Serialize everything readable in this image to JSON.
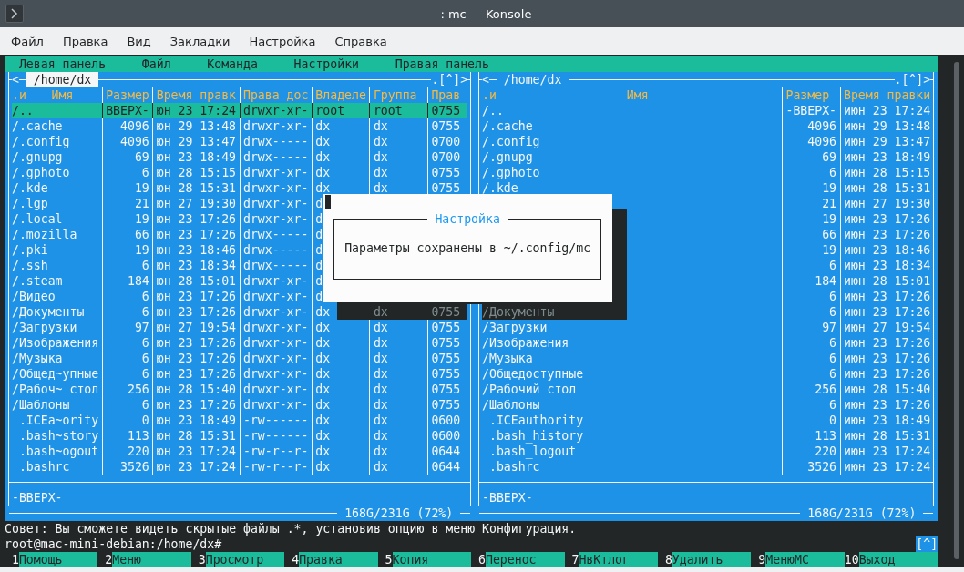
{
  "window": {
    "title": "- : mc — Konsole"
  },
  "menu": [
    "Файл",
    "Правка",
    "Вид",
    "Закладки",
    "Настройка",
    "Справка"
  ],
  "mc_menu": [
    "Левая панель",
    "Файл",
    "Команда",
    "Настройки",
    "Правая панель"
  ],
  "panels": [
    {
      "kind": "full",
      "active": true,
      "left_marker": "<",
      "path": "/home/dx",
      "right_marker": ".[^]>",
      "sort_indicator": ".и",
      "columns": [
        "Имя",
        "Размер",
        "Время правк",
        "Права дос",
        "Владеле",
        "Группа",
        "Прав"
      ],
      "rows": [
        {
          "kind": "dir",
          "name": "/..",
          "size": "ВВЕРХ-",
          "time": "юн 23 17:24",
          "perms": "drwxr-xr-",
          "owner": "root",
          "group": "root",
          "mode": "0755",
          "selected": true
        },
        {
          "kind": "dir",
          "name": "/.cache",
          "size": "4096",
          "time": "юн 29 13:48",
          "perms": "drwxr-xr-",
          "owner": "dx",
          "group": "dx",
          "mode": "0755",
          "selected": false
        },
        {
          "kind": "dir",
          "name": "/.config",
          "size": "4096",
          "time": "юн 29 13:47",
          "perms": "drwx-----",
          "owner": "dx",
          "group": "dx",
          "mode": "0700",
          "selected": false
        },
        {
          "kind": "dir",
          "name": "/.gnupg",
          "size": "69",
          "time": "юн 23 18:49",
          "perms": "drwx-----",
          "owner": "dx",
          "group": "dx",
          "mode": "0700",
          "selected": false
        },
        {
          "kind": "dir",
          "name": "/.gphoto",
          "size": "6",
          "time": "юн 28 15:15",
          "perms": "drwxr-xr-",
          "owner": "dx",
          "group": "dx",
          "mode": "0755",
          "selected": false
        },
        {
          "kind": "dir",
          "name": "/.kde",
          "size": "19",
          "time": "юн 28 15:31",
          "perms": "drwxr-xr-",
          "owner": "dx",
          "group": "dx",
          "mode": "0755",
          "selected": false
        },
        {
          "kind": "dir",
          "name": "/.lgp",
          "size": "21",
          "time": "юн 27 19:30",
          "perms": "drwxr-xr-",
          "owner": "d",
          "selected": false
        },
        {
          "kind": "dir",
          "name": "/.local",
          "size": "19",
          "time": "юн 23 17:26",
          "perms": "drwxr-xr-",
          "owner": "d",
          "selected": false
        },
        {
          "kind": "dir",
          "name": "/.mozilla",
          "size": "66",
          "time": "юн 23 17:26",
          "perms": "drwx-----",
          "owner": "d",
          "selected": false
        },
        {
          "kind": "dir",
          "name": "/.pki",
          "size": "19",
          "time": "юн 23 18:46",
          "perms": "drwx-----",
          "owner": "d",
          "selected": false
        },
        {
          "kind": "dir",
          "name": "/.ssh",
          "size": "6",
          "time": "юн 23 18:34",
          "perms": "drwx-----",
          "owner": "d",
          "selected": false
        },
        {
          "kind": "dir",
          "name": "/.steam",
          "size": "184",
          "time": "юн 28 15:01",
          "perms": "drwxr-xr-",
          "owner": "d",
          "selected": false
        },
        {
          "kind": "dir",
          "name": "/Видео",
          "size": "6",
          "time": "юн 23 17:26",
          "perms": "drwxr-xr-",
          "owner": "d",
          "selected": false
        },
        {
          "kind": "dir",
          "name": "/Документы",
          "size": "6",
          "time": "юн 23 17:26",
          "perms": "drwxr-xr-",
          "owner": "dx",
          "group": "dx",
          "mode": "0755",
          "selected": false,
          "shaded": true
        },
        {
          "kind": "dir",
          "name": "/Загрузки",
          "size": "97",
          "time": "юн 27 19:54",
          "perms": "drwxr-xr-",
          "owner": "dx",
          "group": "dx",
          "mode": "0755",
          "selected": false
        },
        {
          "kind": "dir",
          "name": "/Изображения",
          "size": "6",
          "time": "юн 23 17:26",
          "perms": "drwxr-xr-",
          "owner": "dx",
          "group": "dx",
          "mode": "0755",
          "selected": false
        },
        {
          "kind": "dir",
          "name": "/Музыка",
          "size": "6",
          "time": "юн 23 17:26",
          "perms": "drwxr-xr-",
          "owner": "dx",
          "group": "dx",
          "mode": "0755",
          "selected": false
        },
        {
          "kind": "dir",
          "name": "/Общед~упные",
          "size": "6",
          "time": "юн 23 17:26",
          "perms": "drwxr-xr-",
          "owner": "dx",
          "group": "dx",
          "mode": "0755",
          "selected": false
        },
        {
          "kind": "dir",
          "name": "/Рабоч~ стол",
          "size": "256",
          "time": "юн 28 15:40",
          "perms": "drwxr-xr-",
          "owner": "dx",
          "group": "dx",
          "mode": "0755",
          "selected": false
        },
        {
          "kind": "dir",
          "name": "/Шаблоны",
          "size": "6",
          "time": "юн 23 17:26",
          "perms": "drwxr-xr-",
          "owner": "dx",
          "group": "dx",
          "mode": "0755",
          "selected": false
        },
        {
          "kind": "file",
          "name": ".ICEa~ority",
          "size": "0",
          "time": "юн 23 18:49",
          "perms": "-rw------",
          "owner": "dx",
          "group": "dx",
          "mode": "0600",
          "selected": false
        },
        {
          "kind": "file",
          "name": ".bash~story",
          "size": "113",
          "time": "юн 28 15:31",
          "perms": "-rw------",
          "owner": "dx",
          "group": "dx",
          "mode": "0600",
          "selected": false
        },
        {
          "kind": "file",
          "name": ".bash~ogout",
          "size": "220",
          "time": "юн 23 17:24",
          "perms": "-rw-r--r-",
          "owner": "dx",
          "group": "dx",
          "mode": "0644",
          "selected": false
        },
        {
          "kind": "file",
          "name": ".bashrc",
          "size": "3526",
          "time": "юн 23 17:24",
          "perms": "-rw-r--r-",
          "owner": "dx",
          "group": "dx",
          "mode": "0644",
          "selected": false
        }
      ],
      "mini_status": "-ВВЕРХ-",
      "disk_usage": "168G/231G (72%)"
    },
    {
      "kind": "wide",
      "active": false,
      "left_marker": "<",
      "path": "/home/dx",
      "right_marker": ".[^]>",
      "sort_indicator": ".и",
      "columns": [
        "Имя",
        "Размер",
        "Время правки"
      ],
      "rows": [
        {
          "kind": "dir",
          "name": "/..",
          "size": "-ВВЕРХ-",
          "time": "июн 23 17:24",
          "selected": false
        },
        {
          "kind": "dir",
          "name": "/.cache",
          "size": "4096",
          "time": "июн 29 13:48",
          "selected": false
        },
        {
          "kind": "dir",
          "name": "/.config",
          "size": "4096",
          "time": "июн 29 13:47",
          "selected": false
        },
        {
          "kind": "dir",
          "name": "/.gnupg",
          "size": "69",
          "time": "июн 23 18:49",
          "selected": false
        },
        {
          "kind": "dir",
          "name": "/.gphoto",
          "size": "6",
          "time": "июн 28 15:15",
          "selected": false
        },
        {
          "kind": "dir",
          "name": "/.kde",
          "size": "19",
          "time": "июн 28 15:31",
          "selected": false
        },
        {
          "kind": "dir",
          "size": "21",
          "time": "июн 27 19:30",
          "selected": false
        },
        {
          "kind": "dir",
          "size": "19",
          "time": "июн 23 17:26",
          "selected": false
        },
        {
          "kind": "dir",
          "size": "66",
          "time": "июн 23 17:26",
          "selected": false
        },
        {
          "kind": "dir",
          "size": "19",
          "time": "июн 23 18:46",
          "selected": false
        },
        {
          "kind": "dir",
          "size": "6",
          "time": "июн 23 18:34",
          "selected": false
        },
        {
          "kind": "dir",
          "size": "184",
          "time": "июн 28 15:01",
          "selected": false
        },
        {
          "kind": "dir",
          "size": "6",
          "time": "июн 23 17:26",
          "selected": false
        },
        {
          "kind": "dir",
          "name": "/Документы",
          "size": "6",
          "time": "июн 23 17:26",
          "selected": false,
          "shaded": true
        },
        {
          "kind": "dir",
          "name": "/Загрузки",
          "size": "97",
          "time": "июн 27 19:54",
          "selected": false
        },
        {
          "kind": "dir",
          "name": "/Изображения",
          "size": "6",
          "time": "июн 23 17:26",
          "selected": false
        },
        {
          "kind": "dir",
          "name": "/Музыка",
          "size": "6",
          "time": "июн 23 17:26",
          "selected": false
        },
        {
          "kind": "dir",
          "name": "/Общедоступные",
          "size": "6",
          "time": "июн 23 17:26",
          "selected": false
        },
        {
          "kind": "dir",
          "name": "/Рабочий стол",
          "size": "256",
          "time": "июн 28 15:40",
          "selected": false
        },
        {
          "kind": "dir",
          "name": "/Шаблоны",
          "size": "6",
          "time": "июн 23 17:26",
          "selected": false
        },
        {
          "kind": "file",
          "name": ".ICEauthority",
          "size": "0",
          "time": "июн 23 18:49",
          "selected": false
        },
        {
          "kind": "file",
          "name": ".bash_history",
          "size": "113",
          "time": "июн 28 15:31",
          "selected": false
        },
        {
          "kind": "file",
          "name": ".bash_logout",
          "size": "220",
          "time": "июн 23 17:24",
          "selected": false
        },
        {
          "kind": "file",
          "name": ".bashrc",
          "size": "3526",
          "time": "июн 23 17:24",
          "selected": false
        }
      ],
      "mini_status": "-ВВЕРХ-",
      "disk_usage": "168G/231G (72%)"
    }
  ],
  "dialog": {
    "title": "Настройка",
    "message": "Параметры сохранены в ~/.config/mc"
  },
  "hint": "Совет: Вы сможете видеть скрытые файлы .*, установив опцию в меню Конфигурация.",
  "prompt": "root@mac-mini-debian:/home/dx#",
  "prompt_badge": "[^]",
  "function_keys": [
    {
      "key": "1",
      "label": "Помощь"
    },
    {
      "key": "2",
      "label": "Меню"
    },
    {
      "key": "3",
      "label": "Просмотр"
    },
    {
      "key": "4",
      "label": "Правка"
    },
    {
      "key": "5",
      "label": "Копия"
    },
    {
      "key": "6",
      "label": "Перенос"
    },
    {
      "key": "7",
      "label": "НвКтлог"
    },
    {
      "key": "8",
      "label": "Удалить"
    },
    {
      "key": "9",
      "label": "МенюМС"
    },
    {
      "key": "10",
      "label": "Выход"
    }
  ]
}
